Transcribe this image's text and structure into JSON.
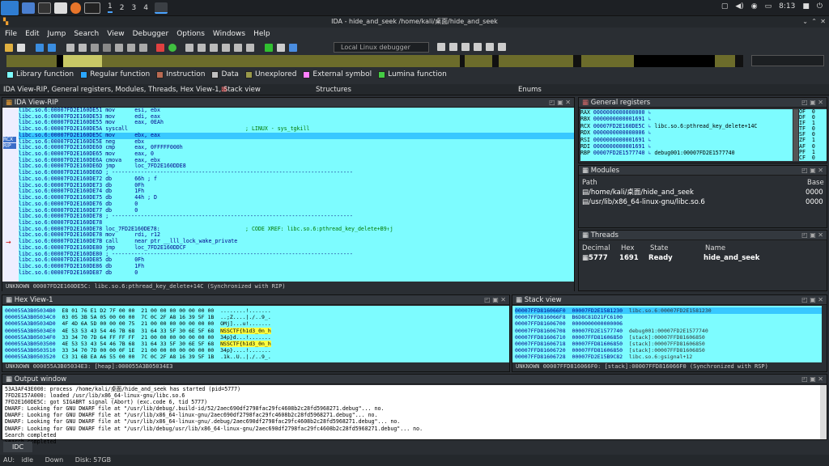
{
  "taskbar": {
    "workspaces": [
      "1",
      "2",
      "3",
      "4"
    ],
    "active_workspace": "1",
    "time": "8:13"
  },
  "window": {
    "title": "IDA - hide_and_seek /home/kali/桌面/hide_and_seek"
  },
  "menu": [
    "File",
    "Edit",
    "Jump",
    "Search",
    "View",
    "Debugger",
    "Options",
    "Windows",
    "Help"
  ],
  "toolbar": {
    "debugger_select": "Local Linux debugger"
  },
  "legend": [
    {
      "label": "Library function",
      "color": "#7dfcff"
    },
    {
      "label": "Regular function",
      "color": "#2aa7ff"
    },
    {
      "label": "Instruction",
      "color": "#b96a52"
    },
    {
      "label": "Data",
      "color": "#c0c0c0"
    },
    {
      "label": "Unexplored",
      "color": "#9a9a4a"
    },
    {
      "label": "External symbol",
      "color": "#ff80ff"
    },
    {
      "label": "Lumina function",
      "color": "#44cc44"
    }
  ],
  "tabs": {
    "main": "IDA View-RIP, General registers, Modules, Threads, Hex View-1, Stack view",
    "structures": "Structures",
    "enums": "Enums"
  },
  "ida_view": {
    "title": "IDA View-RIP",
    "gutter_labels": {
      "rcx": "RCX",
      "rip": "RIP"
    },
    "lines": [
      {
        "a": "libc.so.6:00007FD2E160DE51",
        "m": "mov",
        "o": "esi, ebx",
        "c": ""
      },
      {
        "a": "libc.so.6:00007FD2E160DE53",
        "m": "mov",
        "o": "edi, eax",
        "c": ""
      },
      {
        "a": "libc.so.6:00007FD2E160DE55",
        "m": "mov",
        "o": "eax, 0EAh",
        "c": ""
      },
      {
        "a": "libc.so.6:00007FD2E160DE5A",
        "m": "syscall",
        "o": "",
        "c": "; LINUX - sys_tgkill"
      },
      {
        "a": "libc.so.6:00007FD2E160DE5C",
        "m": "mov",
        "o": "ebx, eax",
        "c": "",
        "hl": true
      },
      {
        "a": "libc.so.6:00007FD2E160DE5E",
        "m": "neg",
        "o": "ebx",
        "c": ""
      },
      {
        "a": "libc.so.6:00007FD2E160DE60",
        "m": "cmp",
        "o": "eax, 0FFFFF000h",
        "c": ""
      },
      {
        "a": "libc.so.6:00007FD2E160DE65",
        "m": "mov",
        "o": "eax, 0",
        "c": ""
      },
      {
        "a": "libc.so.6:00007FD2E160DE6A",
        "m": "cmova",
        "o": "eax, ebx",
        "c": ""
      },
      {
        "a": "libc.so.6:00007FD2E160DE6D",
        "m": "jmp",
        "o": "loc_7FD2E160DDE8",
        "c": ""
      },
      {
        "a": "libc.so.6:00007FD2E160DE6D",
        "m": "; ---------------------------------------------------------------------------",
        "o": "",
        "c": ""
      },
      {
        "a": "libc.so.6:00007FD2E160DE72",
        "m": "db",
        "o": "66h ; f",
        "c": ""
      },
      {
        "a": "libc.so.6:00007FD2E160DE73",
        "m": "db",
        "o": "0Fh",
        "c": ""
      },
      {
        "a": "libc.so.6:00007FD2E160DE74",
        "m": "db",
        "o": "1Fh",
        "c": ""
      },
      {
        "a": "libc.so.6:00007FD2E160DE75",
        "m": "db",
        "o": "44h ; D",
        "c": ""
      },
      {
        "a": "libc.so.6:00007FD2E160DE76",
        "m": "db",
        "o": "0",
        "c": ""
      },
      {
        "a": "libc.so.6:00007FD2E160DE77",
        "m": "db",
        "o": "0",
        "c": ""
      },
      {
        "a": "libc.so.6:00007FD2E160DE78",
        "m": "; ---------------------------------------------------------------------------",
        "o": "",
        "c": ""
      },
      {
        "a": "libc.so.6:00007FD2E160DE78",
        "m": "",
        "o": "",
        "c": ""
      },
      {
        "a": "libc.so.6:00007FD2E160DE78",
        "m": "loc_7FD2E160DE78:",
        "o": "",
        "c": "; CODE XREF: libc.so.6:pthread_key_delete+B9↑j"
      },
      {
        "a": "libc.so.6:00007FD2E160DE78",
        "m": "mov",
        "o": "rdi, r12",
        "c": ""
      },
      {
        "a": "libc.so.6:00007FD2E160DE7B",
        "m": "call",
        "o": "near ptr __lll_lock_wake_private",
        "c": ""
      },
      {
        "a": "libc.so.6:00007FD2E160DE80",
        "m": "jmp",
        "o": "loc_7FD2E160DDCF",
        "c": ""
      },
      {
        "a": "libc.so.6:00007FD2E160DE80",
        "m": "; ---------------------------------------------------------------------------",
        "o": "",
        "c": ""
      },
      {
        "a": "libc.so.6:00007FD2E160DE85",
        "m": "db",
        "o": "0Fh",
        "c": ""
      },
      {
        "a": "libc.so.6:00007FD2E160DE86",
        "m": "db",
        "o": "1Fh",
        "c": ""
      },
      {
        "a": "libc.so.6:00007FD2E160DE87",
        "m": "db",
        "o": "0",
        "c": ""
      }
    ],
    "status": "UNKNOWN 00007FD2E160DE5C: libc.so.6:pthread_key_delete+14C (Synchronized with RIP)"
  },
  "registers": {
    "title": "General registers",
    "rows": [
      {
        "n": "RAX",
        "v": "0000000000000000",
        "d": ""
      },
      {
        "n": "RBX",
        "v": "0000000000001691",
        "d": ""
      },
      {
        "n": "RCX",
        "v": "00007FD2E160DE5C",
        "d": "libc.so.6:pthread_key_delete+14C"
      },
      {
        "n": "RDX",
        "v": "0000000000000006",
        "d": ""
      },
      {
        "n": "RSI",
        "v": "0000000000001691",
        "d": ""
      },
      {
        "n": "RDI",
        "v": "0000000000001691",
        "d": ""
      },
      {
        "n": "RBP",
        "v": "00007FD2E1577740",
        "d": "debug001:00007FD2E1577740"
      }
    ],
    "flags": [
      {
        "n": "OF",
        "v": "0"
      },
      {
        "n": "DF",
        "v": "0"
      },
      {
        "n": "IF",
        "v": "1"
      },
      {
        "n": "TF",
        "v": "0"
      },
      {
        "n": "SF",
        "v": "0"
      },
      {
        "n": "ZF",
        "v": "1"
      },
      {
        "n": "AF",
        "v": "0"
      },
      {
        "n": "PF",
        "v": "1"
      },
      {
        "n": "CF",
        "v": "0"
      }
    ]
  },
  "modules": {
    "title": "Modules",
    "header": {
      "path": "Path",
      "base": "Base"
    },
    "rows": [
      {
        "path": "/home/kali/桌面/hide_and_seek",
        "base": "0000"
      },
      {
        "path": "/usr/lib/x86_64-linux-gnu/libc.so.6",
        "base": "0000"
      }
    ]
  },
  "threads": {
    "title": "Threads",
    "header": {
      "decimal": "Decimal",
      "hex": "Hex",
      "state": "State",
      "name": "Name"
    },
    "rows": [
      {
        "decimal": "5777",
        "hex": "1691",
        "state": "Ready",
        "name": "hide_and_seek"
      }
    ]
  },
  "hex_view": {
    "title": "Hex View-1",
    "rows": [
      {
        "a": "000055A3B05034B0",
        "h": "E8 01 76 E1 D2 7F 00 00  21 00 00 00 00 00 00 00",
        "s": "........!......."
      },
      {
        "a": "000055A3B05034C0",
        "h": "03 05 3B 5A 05 00 00 00  7C 0C 2F A8 16 39 5F 1B",
        "s": "..;Z....|./..9_."
      },
      {
        "a": "000055A3B05034D0",
        "h": "4F 4D 6A 5D 00 00 00 75  21 00 00 00 00 00 00 00",
        "s": "OMj]...u!......."
      },
      {
        "a": "000055A3B05034E0",
        "h": "4E 53 53 43 54 46 7B 68  31 64 33 5F 30 6E 5F 68",
        "s": "NSSCTF{h1d3_0n_h",
        "hl": "NSSCTF{h1d3_0n_h"
      },
      {
        "a": "000055A3B05034F0",
        "h": "33 34 70 7D 64 FF FF FF  21 00 00 00 00 00 00 00",
        "s": "34p}d...!......."
      },
      {
        "a": "000055A3B0503500",
        "h": "4E 53 53 43 54 46 7B 68  31 64 33 5F 30 6E 5F 68",
        "s": "NSSCTF{h1d3_0n_h",
        "hl": "NSSCTF{h1d3_0n_h"
      },
      {
        "a": "000055A3B0503510",
        "h": "33 34 70 7D 00 00 0F 1E  21 00 00 00 00 00 00 00",
        "s": "34p}....!......."
      },
      {
        "a": "000055A3B0503520",
        "h": "C3 31 6B EA A6 55 00 00  7C 0C 2F A8 16 39 5F 1B",
        "s": ".1k..U..|./..9_."
      }
    ],
    "status": "UNKNOWN 000055A3B05034E3: [heap]:000055A3B05034E3"
  },
  "stack_view": {
    "title": "Stack view",
    "rows": [
      {
        "a": "00007FFD816066F0",
        "v": "00007FD2E1581230",
        "d": "libc.so.6:00007FD2E1581230",
        "hl": true
      },
      {
        "a": "00007FFD816066F8",
        "v": "B6D8C81D21FC6100",
        "d": ""
      },
      {
        "a": "00007FFD81606700",
        "v": "0000000000000006",
        "d": ""
      },
      {
        "a": "00007FFD81606708",
        "v": "00007FD2E1577740",
        "d": "debug001:00007FD2E1577740"
      },
      {
        "a": "00007FFD81606710",
        "v": "00007FFD81606850",
        "d": "[stack]:00007FFD81606850"
      },
      {
        "a": "00007FFD81606718",
        "v": "00007FFD81606850",
        "d": "[stack]:00007FFD81606850"
      },
      {
        "a": "00007FFD81606720",
        "v": "00007FFD81606850",
        "d": "[stack]:00007FFD81606850"
      },
      {
        "a": "00007FFD81606728",
        "v": "00007FD2E15B9C82",
        "d": "libc.so.6:gsignal+12"
      }
    ],
    "status": "UNKNOWN 00007FFD816066F0: [stack]:00007FFD816066F0 (Synchronized with RSP)"
  },
  "output": {
    "title": "Output window",
    "lines": [
      "53A3AF43E000: process /home/kali/桌面/hide_and_seek has started (pid=5777)",
      "7FD2E157A000: loaded /usr/lib/x86_64-linux-gnu/libc.so.6",
      "7FD2E160DE5C: got SIGABRT signal (Abort) (exc.code 6, tid 5777)",
      "DWARF: Looking for GNU DWARF file at \"/usr/lib/debug/.build-id/52/2aec690df2798fac29fc4608b2c28fd5968271.debug\"... no.",
      "DWARF: Looking for GNU DWARF file at \"/usr/lib/x86_64-linux-gnu/2aec690df2798fac29fc4608b2c28fd5968271.debug\"... no.",
      "DWARF: Looking for GNU DWARF file at \"/usr/lib/x86_64-linux-gnu/.debug/2aec690df2798fac29fc4608b2c28fd5968271.debug\"... no.",
      "DWARF: Looking for GNU DWARF file at \"/usr/lib/debug/usr/lib/x86_64-linux-gnu/2aec690df2798fac29fc4608b2c28fd5968271.debug\"... no.",
      "Search completed",
      "Search completed"
    ]
  },
  "bottom_tab": "IDC",
  "statusbar": {
    "au": "AU:",
    "state": "idle",
    "direction": "Down",
    "disk": "Disk: 57GB"
  }
}
